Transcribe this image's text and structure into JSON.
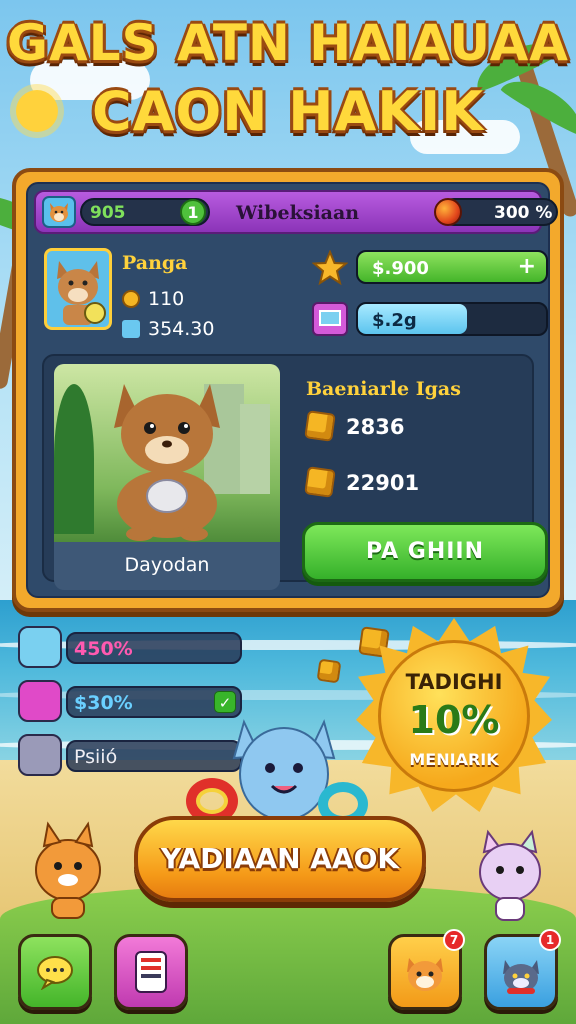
{
  "title": {
    "line1": "GALS  ATN HAIAUAA",
    "line2": "CAON HAKIK"
  },
  "topbar": {
    "coins": "905",
    "plus": "1",
    "name": "Wibeksiaan",
    "percent": "300 %"
  },
  "player": {
    "name": "Panga",
    "stat1": "110",
    "stat2": "354.30"
  },
  "bars": {
    "money": {
      "label": "$.900",
      "fill": 1.0,
      "color": "#5cc838",
      "action": "+"
    },
    "energy": {
      "label": "$.2g",
      "fill": 0.58,
      "color": "#7dd8f6"
    }
  },
  "pet": {
    "name": "Dayodan"
  },
  "resources": {
    "title": "Baeniarle Igas",
    "items": [
      {
        "value": "2836"
      },
      {
        "value": "22901"
      }
    ]
  },
  "play_button": "PA GHIIN",
  "side_stats": [
    {
      "value": "450%",
      "color": "#ff5ab0"
    },
    {
      "value": "$30%",
      "color": "#6ad0ff"
    },
    {
      "value": "Psiió",
      "color": "#e8e8f0"
    }
  ],
  "badge": {
    "line1": "TADIGHI",
    "line2": "10%",
    "line3": "MENIARIK"
  },
  "cta": "YADIAAN AAOK",
  "nav": {
    "chat_badge": "",
    "pet1_badge": "7",
    "pet2_badge": "1"
  },
  "colors": {
    "panel": "#f3a92c",
    "accent_green": "#35b02a",
    "title_yellow": "#ffd93b"
  }
}
